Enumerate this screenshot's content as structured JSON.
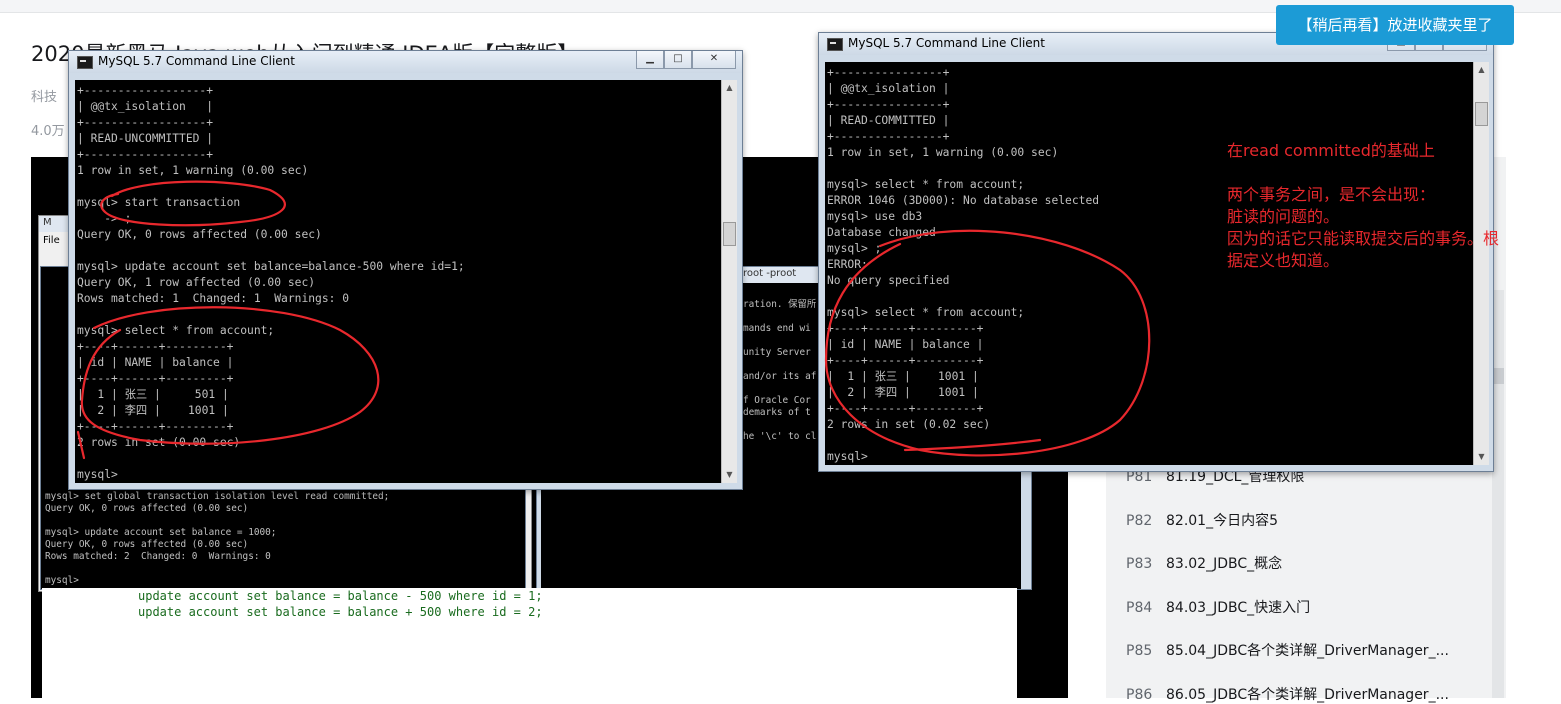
{
  "page": {
    "title": "2020最新黑马 Java web从入门到精通 IDEA版【完整版】",
    "category": "科技",
    "views": "4.0万",
    "later_tip": "【稍后再看】放进收藏夹里了"
  },
  "episodes": [
    {
      "num": "P81",
      "title": "81.19_DCL_管理权限"
    },
    {
      "num": "P82",
      "title": "82.01_今日内容5"
    },
    {
      "num": "P83",
      "title": "83.02_JDBC_概念"
    },
    {
      "num": "P84",
      "title": "84.03_JDBC_快速入门"
    },
    {
      "num": "P85",
      "title": "85.04_JDBC各个类详解_DriverManager_..."
    },
    {
      "num": "P86",
      "title": "86.05_JDBC各个类详解_DriverManager_..."
    }
  ],
  "window_left": {
    "title": "MySQL 5.7 Command Line Client",
    "console": "+------------------+\n| @@tx_isolation   |\n+------------------+\n| READ-UNCOMMITTED |\n+------------------+\n1 row in set, 1 warning (0.00 sec)\n\nmysql> start transaction\n    -> ;\nQuery OK, 0 rows affected (0.00 sec)\n\nmysql> update account set balance=balance-500 where id=1;\nQuery OK, 1 row affected (0.00 sec)\nRows matched: 1  Changed: 1  Warnings: 0\n\nmysql> select * from account;\n+----+------+---------+\n| id | NAME | balance |\n+----+------+---------+\n|  1 | 张三 |     501 |\n|  2 | 李四 |    1001 |\n+----+------+---------+\n2 rows in set (0.00 sec)\n\nmysql>"
  },
  "window_right": {
    "title": "MySQL 5.7 Command Line Client",
    "console": "+----------------+\n| @@tx_isolation |\n+----------------+\n| READ-COMMITTED |\n+----------------+\n1 row in set, 1 warning (0.00 sec)\n\nmysql> select * from account;\nERROR 1046 (3D000): No database selected\nmysql> use db3\nDatabase changed\nmysql> ;\nERROR:\nNo query specified\n\nmysql> select * from account;\n+----+------+---------+\n| id | NAME | balance |\n+----+------+---------+\n|  1 | 张三 |    1001 |\n|  2 | 李四 |    1001 |\n+----+------+---------+\n2 rows in set (0.02 sec)\n\nmysql>"
  },
  "behind_left": {
    "console": "mysql> set global transaction isolation level read committed;\nQuery OK, 0 rows affected (0.00 sec)\n\nmysql> update account set balance = 1000;\nQuery OK, 0 rows affected (0.00 sec)\nRows matched: 2  Changed: 0  Warnings: 0\n\nmysql>"
  },
  "behind_mid": {
    "title": "root -proot",
    "console": "ration. 保留所\n\nmands end wi\n\nunity Server\n\nand/or its af\n\nf Oracle Cor\ndemarks of t\n\nhe '\\c' to cl"
  },
  "workbench": {
    "menu": "File",
    "code": "update account set balance = balance - 500 where id = 1;\nupdate account set balance = balance + 500 where id = 2;"
  },
  "annotation": "在read committed的基础上\n\n两个事务之间，是不会出现：\n脏读的问题的。\n因为的话它只能读取提交后的事务。根\n据定义也知道。",
  "colors": {
    "annotation": "#e8282d",
    "console_bg": "#000000",
    "console_text": "#c0c0c0",
    "tip_bg": "#1c9bd6"
  }
}
